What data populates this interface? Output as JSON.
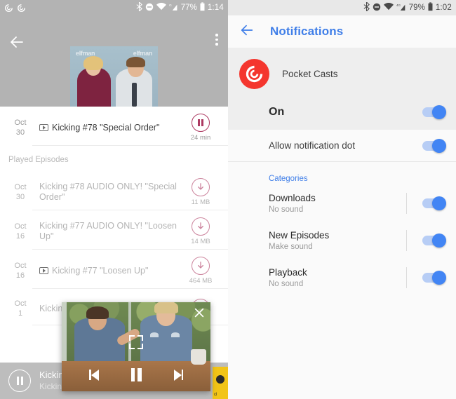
{
  "left_screen": {
    "statusbar": {
      "app_icons": [
        "pocket-casts-icon",
        "pocket-casts-icon"
      ],
      "icons": [
        "bluetooth-icon",
        "do-not-disturb-icon",
        "wifi-icon",
        "cell-signal-g-icon"
      ],
      "battery": "77%",
      "time": "1:14"
    },
    "header": {
      "back_icon": "back-arrow-icon",
      "overflow_icon": "more-vertical-icon",
      "artwork_label_left": "elfman",
      "artwork_label_right": "elfman"
    },
    "current_episode": {
      "date_month": "Oct",
      "date_day": "30",
      "has_video": true,
      "title": "Kicking #78 \"Special Order\"",
      "action_icon": "pause-circle-icon",
      "meta": "24 min"
    },
    "section_header": "Played Episodes",
    "played_episodes": [
      {
        "date_month": "Oct",
        "date_day": "30",
        "has_video": false,
        "title": "Kicking #78 AUDIO ONLY! \"Special Order\"",
        "action_icon": "download-circle-icon",
        "meta": "11 MB"
      },
      {
        "date_month": "Oct",
        "date_day": "16",
        "has_video": false,
        "title": "Kicking #77 AUDIO ONLY! \"Loosen Up\"",
        "action_icon": "download-circle-icon",
        "meta": "14 MB"
      },
      {
        "date_month": "Oct",
        "date_day": "16",
        "has_video": true,
        "title": "Kicking #77 \"Loosen Up\"",
        "action_icon": "download-circle-icon",
        "meta": "464 MB"
      },
      {
        "date_month": "Oct",
        "date_day": "1",
        "has_video": false,
        "title": "Kickin",
        "title_line2": "Woma",
        "action_icon": "download-circle-icon",
        "meta": ""
      }
    ],
    "mini_player": {
      "play_icon": "pause-circle-icon",
      "title": "Kicking",
      "subtitle": "Kicking"
    }
  },
  "pip": {
    "close_icon": "close-icon",
    "expand_icon": "fullscreen-icon",
    "prev_icon": "skip-previous-icon",
    "pause_icon": "pause-icon",
    "next_icon": "skip-next-icon"
  },
  "right_screen": {
    "statusbar": {
      "icons": [
        "bluetooth-icon",
        "do-not-disturb-icon",
        "wifi-icon",
        "cell-signal-4g-icon"
      ],
      "battery": "79%",
      "time": "1:02"
    },
    "header": {
      "back_icon": "back-arrow-icon",
      "title": "Notifications"
    },
    "app": {
      "logo_icon": "pocket-casts-logo",
      "name": "Pocket Casts"
    },
    "master_toggle": {
      "label": "On",
      "enabled": true
    },
    "notification_dot": {
      "label": "Allow notification dot",
      "enabled": true
    },
    "categories_header": "Categories",
    "categories": [
      {
        "title": "Downloads",
        "sub": "No sound",
        "enabled": true
      },
      {
        "title": "New Episodes",
        "sub": "Make sound",
        "enabled": true
      },
      {
        "title": "Playback",
        "sub": "No sound",
        "enabled": true
      }
    ]
  },
  "colors": {
    "accent_crimson": "#ad3a62",
    "accent_blue": "#4285f4",
    "title_blue": "#3f7ee8",
    "pocket_casts_red": "#f4362e",
    "header_gray": "#b3b3b3"
  }
}
